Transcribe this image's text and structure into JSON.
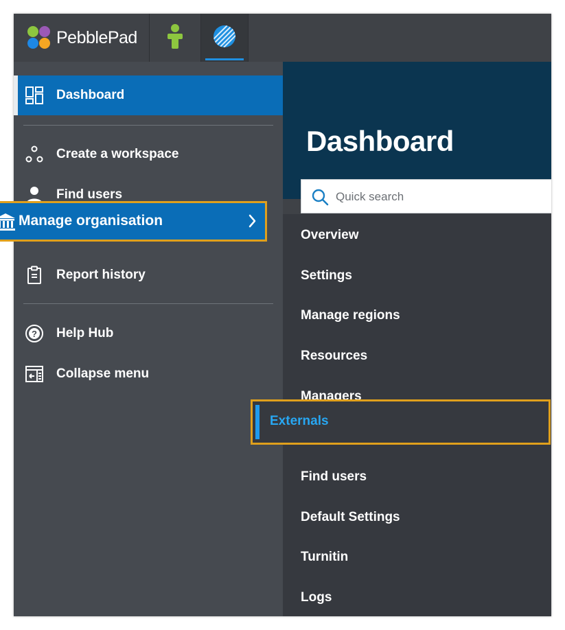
{
  "app": {
    "logo_text": "PebblePad",
    "colors": {
      "accent": "#0a6db7",
      "highlight": "#e0a01c",
      "header": "#0b3550",
      "active_link": "#28a7f2"
    }
  },
  "tabs": [
    {
      "name": "pebblepad-app-tab",
      "icon": "person-icon"
    },
    {
      "name": "atlas-tab",
      "icon": "atlas-globe-icon",
      "active": true
    }
  ],
  "sidebar": {
    "items": [
      {
        "label": "Dashboard",
        "icon": "dashboard-icon",
        "active": true
      },
      {
        "label": "Create a workspace",
        "icon": "workspace-icon"
      },
      {
        "label": "Find users",
        "icon": "user-icon"
      },
      {
        "label": "Manage organisation",
        "icon": "institution-icon",
        "expanded": true
      },
      {
        "label": "Report history",
        "icon": "clipboard-icon"
      },
      {
        "label": "Help Hub",
        "icon": "help-icon"
      },
      {
        "label": "Collapse menu",
        "icon": "collapse-icon"
      }
    ]
  },
  "header": {
    "title": "Dashboard"
  },
  "search": {
    "placeholder": "Quick search"
  },
  "submenu": {
    "items": [
      {
        "label": "Overview"
      },
      {
        "label": "Settings"
      },
      {
        "label": "Manage regions"
      },
      {
        "label": "Resources"
      },
      {
        "label": "Managers"
      },
      {
        "label": "Externals",
        "active": true
      },
      {
        "label": "Find users"
      },
      {
        "label": "Default Settings"
      },
      {
        "label": "Turnitin"
      },
      {
        "label": "Logs"
      }
    ]
  }
}
